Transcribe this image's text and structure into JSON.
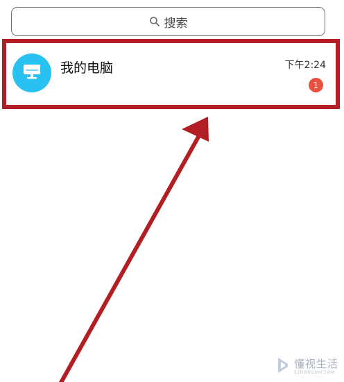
{
  "search": {
    "label": "搜索",
    "icon": "search-icon"
  },
  "chat_list": {
    "items": [
      {
        "name": "我的电脑",
        "time": "下午2:24",
        "unread": "1",
        "avatar_icon": "computer-icon",
        "avatar_color": "#28c1f2"
      }
    ]
  },
  "annotation": {
    "color": "#b21e23"
  },
  "watermark": {
    "title": "懂视生活",
    "subtitle": "51DONGSHI.COM"
  },
  "colors": {
    "badge": "#e8513e",
    "accent": "#28c1f2"
  }
}
